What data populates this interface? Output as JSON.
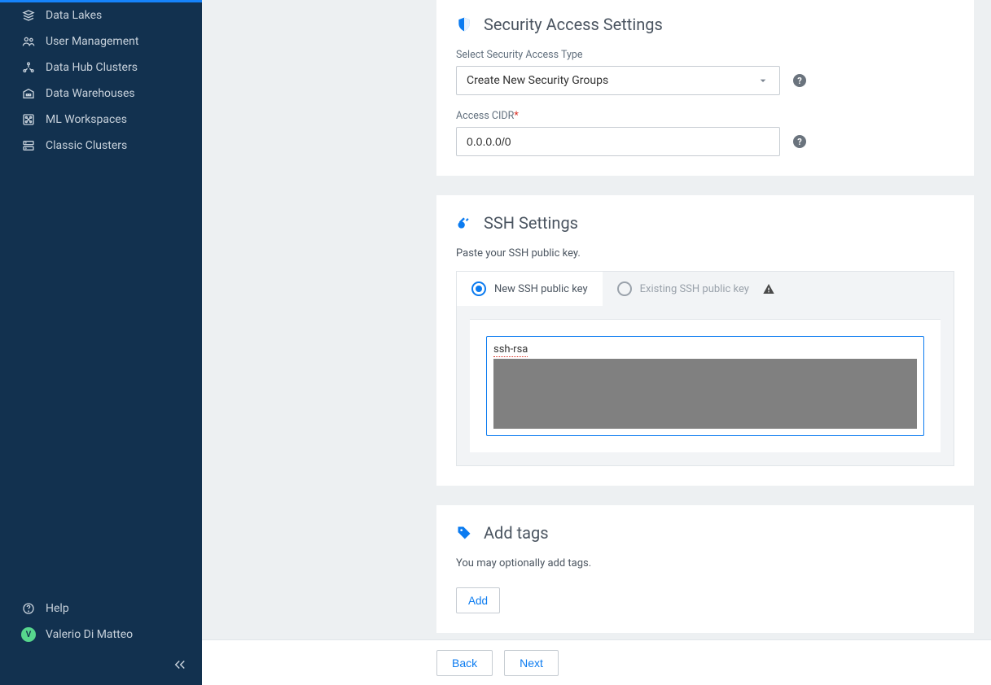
{
  "sidebar": {
    "items": [
      {
        "label": "Data Lakes"
      },
      {
        "label": "User Management"
      },
      {
        "label": "Data Hub Clusters"
      },
      {
        "label": "Data Warehouses"
      },
      {
        "label": "ML Workspaces"
      },
      {
        "label": "Classic Clusters"
      }
    ],
    "help_label": "Help",
    "user": {
      "initial": "V",
      "name": "Valerio Di Matteo"
    }
  },
  "security": {
    "title": "Security Access Settings",
    "select_label": "Select Security Access Type",
    "select_value": "Create New Security Groups",
    "cidr_label": "Access CIDR",
    "cidr_value": "0.0.0.0/0"
  },
  "ssh": {
    "title": "SSH Settings",
    "hint": "Paste your SSH public key.",
    "tab_new": "New SSH public key",
    "tab_existing": "Existing SSH public key",
    "textarea_prefix": "ssh-rsa"
  },
  "tags": {
    "title": "Add tags",
    "hint": "You may optionally add tags.",
    "add_label": "Add"
  },
  "footer": {
    "back": "Back",
    "next": "Next"
  }
}
